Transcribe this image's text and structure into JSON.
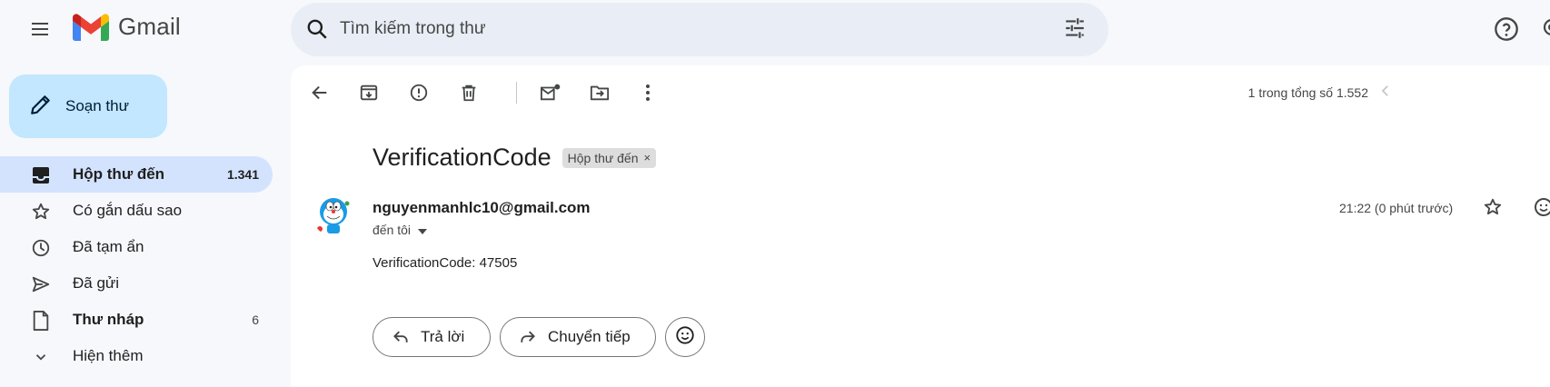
{
  "app": {
    "name": "Gmail",
    "logo_icon": "gmail-m-logo",
    "menu_icon": "hamburger-menu-icon"
  },
  "search": {
    "placeholder": "Tìm kiếm trong thư",
    "icon": "search-icon",
    "options_icon": "tune-icon"
  },
  "header_icons": [
    "help-icon",
    "settings-icon"
  ],
  "compose": {
    "label": "Soạn thư",
    "icon": "pencil-icon",
    "color": "#c2e7ff"
  },
  "sidebar": {
    "items": [
      {
        "label": "Hộp thư đến",
        "count": "1.341",
        "icon": "inbox-icon",
        "active": true,
        "bold": true
      },
      {
        "label": "Có gắn dấu sao",
        "count": "",
        "icon": "star-icon",
        "active": false,
        "bold": false
      },
      {
        "label": "Đã tạm ẩn",
        "count": "",
        "icon": "clock-icon",
        "active": false,
        "bold": false
      },
      {
        "label": "Đã gửi",
        "count": "",
        "icon": "send-icon",
        "active": false,
        "bold": false
      },
      {
        "label": "Thư nháp",
        "count": "6",
        "icon": "draft-icon",
        "active": false,
        "bold": true
      },
      {
        "label": "Hiện thêm",
        "count": "",
        "icon": "chevron-down-icon",
        "active": false,
        "bold": false
      }
    ]
  },
  "toolbar": {
    "icons": [
      "back-arrow-icon",
      "archive-icon",
      "report-spam-icon",
      "delete-icon",
      "mark-unread-icon",
      "move-to-icon",
      "more-vert-icon"
    ],
    "pager": "1 trong tổng số 1.552",
    "prev_icon": "chevron-left-icon"
  },
  "message": {
    "subject": "VerificationCode",
    "label_chip": "Hộp thư đến",
    "label_chip_close": "×",
    "sender": "nguyenmanhlc10@gmail.com",
    "recipient": "đến tôi",
    "timestamp": "21:22 (0 phút trước)",
    "body": "VerificationCode: 47505"
  },
  "actions": {
    "reply_label": "Trả lời",
    "forward_label": "Chuyển tiếp",
    "emoji_icon": "emoji-icon"
  },
  "colors": {
    "background": "#f6f8fc",
    "search_bg": "#e9eef6",
    "active_nav": "#d3e3fd",
    "main_panel": "#ffffff"
  }
}
